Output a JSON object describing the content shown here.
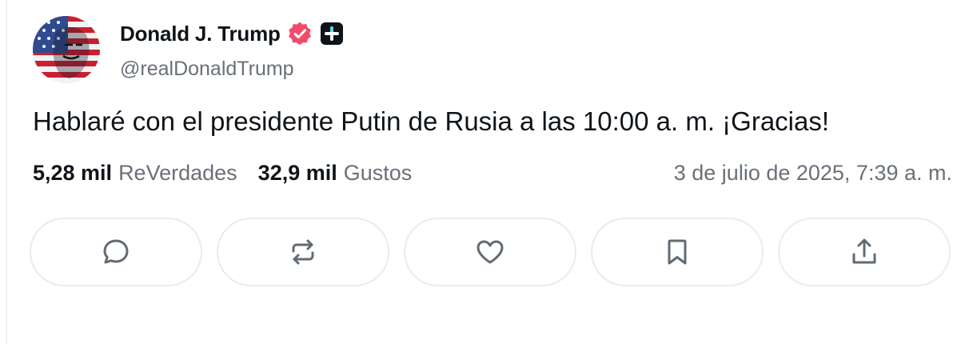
{
  "post": {
    "author_name": "Donald J. Trump",
    "author_handle": "@realDonaldTrump",
    "text": "Hablaré con el presidente Putin de Rusia a las 10:00 a. m. ¡Gracias!",
    "reposts_count": "5,28 mil",
    "reposts_label": "ReVerdades",
    "likes_count": "32,9 mil",
    "likes_label": "Gustos",
    "timestamp": "3 de julio de 2025, 7:39 a. m."
  },
  "badges": {
    "verified_color": "#ef4d6b",
    "plus_badge_color": "#0f1419",
    "plus_badge_accent": "#5ad3e0"
  },
  "actions": [
    {
      "icon": "reply-icon"
    },
    {
      "icon": "retruth-icon"
    },
    {
      "icon": "like-icon"
    },
    {
      "icon": "bookmark-icon"
    },
    {
      "icon": "share-icon"
    }
  ]
}
